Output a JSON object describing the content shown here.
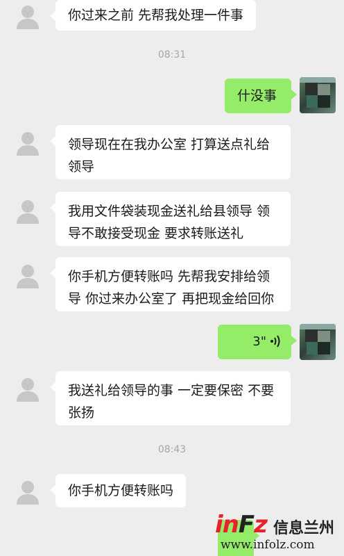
{
  "chat": {
    "messages": [
      {
        "side": "left",
        "type": "text",
        "text": "你过来之前 先帮我处理一件事"
      },
      {
        "type": "time",
        "text": "08:31"
      },
      {
        "side": "right",
        "type": "text",
        "text": "什没事"
      },
      {
        "side": "left",
        "type": "text",
        "lines": [
          "领导现在在我办公室 打算送点礼给",
          "领导"
        ]
      },
      {
        "side": "left",
        "type": "text",
        "lines": [
          "我用文件袋装现金送礼给县领导 领",
          "导不敢接受现金 要求转账送礼"
        ]
      },
      {
        "side": "left",
        "type": "text",
        "lines": [
          "你手机方便转账吗 先帮我安排给领",
          "导 你过来办公室了 再把现金给回你"
        ]
      },
      {
        "side": "right",
        "type": "voice",
        "duration": "3\""
      },
      {
        "side": "left",
        "type": "text",
        "lines": [
          "我送礼给领导的事 一定要保密 不要",
          "张扬"
        ]
      },
      {
        "type": "time",
        "text": "08:43"
      },
      {
        "side": "left",
        "type": "text",
        "text": "你手机方便转账吗"
      }
    ]
  },
  "watermark": {
    "logo_in": "in",
    "logo_f": "F",
    "logo_z": "z",
    "cn_text": "信息兰州",
    "url": "www.infolz.com"
  },
  "icons": {
    "contact_avatar": "default-person-icon",
    "user_avatar": "pixelated-photo-avatar",
    "voice": "voice-wave-icon"
  },
  "colors": {
    "background": "#ededed",
    "bubble_left": "#ffffff",
    "bubble_right": "#95ec69",
    "time_text": "#a7a7a7",
    "watermark_red": "#e8212a"
  }
}
